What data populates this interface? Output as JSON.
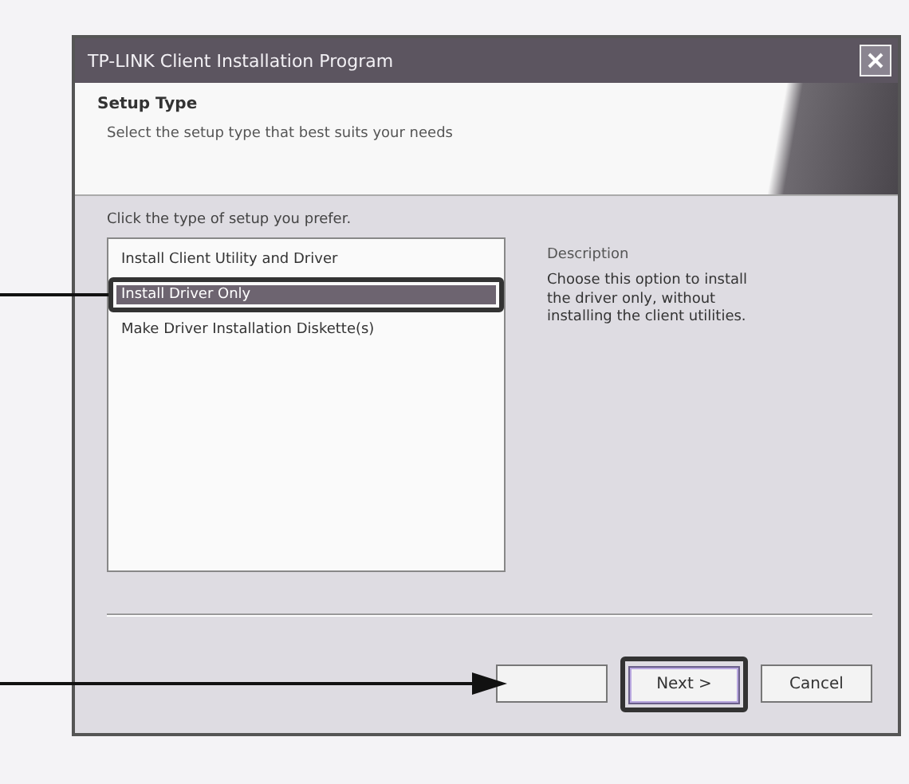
{
  "window": {
    "title": "TP-LINK Client Installation Program"
  },
  "header": {
    "title": "Setup Type",
    "subtitle": "Select the setup type that best suits your needs"
  },
  "prompt": "Click the type of setup you prefer.",
  "options": [
    {
      "label": "Install Client Utility and Driver",
      "selected": false
    },
    {
      "label": "Install Driver Only",
      "selected": true
    },
    {
      "label": "Make Driver Installation Diskette(s)",
      "selected": false
    }
  ],
  "description": {
    "title": "Description",
    "text": "Choose this option to install the driver only, without installing the client utilities."
  },
  "buttons": [
    {
      "kind": "back"
    },
    {
      "kind": "next",
      "label": "Next >"
    },
    {
      "kind": "cancel",
      "label": "Cancel"
    }
  ]
}
